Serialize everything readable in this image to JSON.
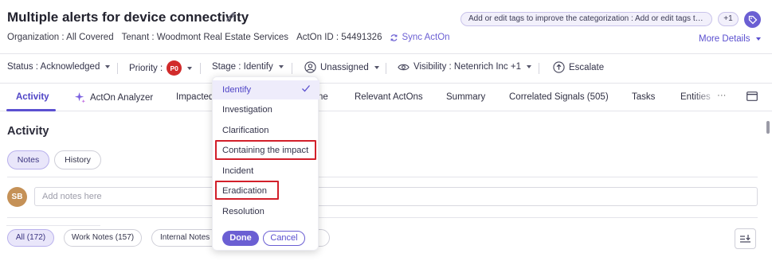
{
  "header": {
    "title": "Multiple alerts for device connectivity",
    "organization": "Organization : All Covered",
    "tenant": "Tenant : Woodmont Real Estate Services",
    "acton_id": "ActOn ID : 54491326",
    "sync_label": "Sync ActOn",
    "tag_placeholder": "Add or edit tags to improve the categorization : Add or edit tags to im...",
    "tag_count": "+1",
    "more_details": "More Details"
  },
  "statusbar": {
    "status": "Status : Acknowledged",
    "priority_label": "Priority :",
    "priority_value": "P0",
    "stage": "Stage : Identify",
    "assignee": "Unassigned",
    "visibility": "Visibility : Netenrich Inc +1",
    "escalate": "Escalate"
  },
  "tabs": [
    {
      "label": "Activity"
    },
    {
      "label": "ActOn Analyzer"
    },
    {
      "label": "Impacted"
    },
    {
      "label": "ne"
    },
    {
      "label": "Relevant ActOns"
    },
    {
      "label": "Summary"
    },
    {
      "label": "Correlated Signals (505)"
    },
    {
      "label": "Tasks"
    },
    {
      "label": "Entities"
    },
    {
      "label": "···"
    }
  ],
  "activity": {
    "title": "Activity",
    "notes_label": "Notes",
    "history_label": "History",
    "avatar_initials": "SB",
    "notes_placeholder": "Add notes here",
    "filters": {
      "all": "All (172)",
      "work": "Work Notes (157)",
      "internal": "Internal Notes ("
    }
  },
  "stage_dropdown": {
    "options": [
      {
        "label": "Identify",
        "selected": true
      },
      {
        "label": "Investigation"
      },
      {
        "label": "Clarification"
      },
      {
        "label": "Containing the impact",
        "highlighted": true
      },
      {
        "label": "Incident"
      },
      {
        "label": "Eradication",
        "highlighted": true
      },
      {
        "label": "Resolution"
      }
    ],
    "done_label": "Done",
    "cancel_label": "Cancel"
  },
  "colors": {
    "accent": "#6b5fd3",
    "priority_badge": "#d12b2b",
    "highlight_box": "#d21f2a"
  }
}
